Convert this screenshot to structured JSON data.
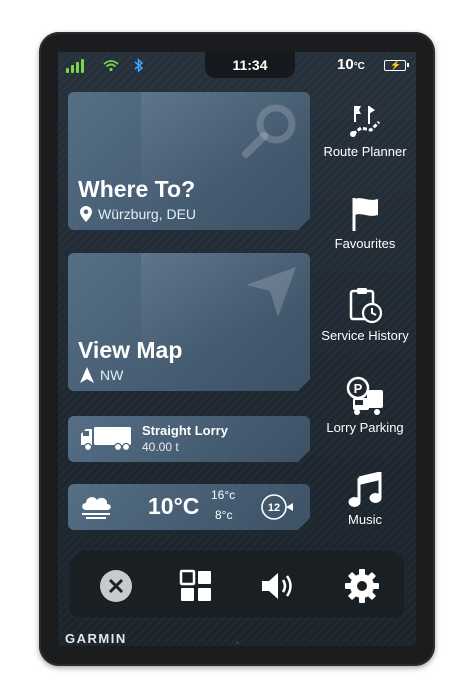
{
  "brand": "GARMIN",
  "status": {
    "time": "11:34",
    "temperature": "10",
    "temperature_unit": "°C"
  },
  "tiles": {
    "where_to": {
      "title": "Where To?",
      "location": "Würzburg, DEU"
    },
    "view_map": {
      "title": "View Map",
      "heading": "NW"
    },
    "vehicle": {
      "title": "Straight Lorry",
      "weight": "40.00 t"
    },
    "weather": {
      "temp": "10°C",
      "high": "16°c",
      "low": "8°c",
      "wind_speed": "12"
    }
  },
  "shortcuts": [
    {
      "label": "Route Planner",
      "icon": "route-planner-icon"
    },
    {
      "label": "Favourites",
      "icon": "flag-icon"
    },
    {
      "label": "Service History",
      "icon": "service-history-icon"
    },
    {
      "label": "Lorry Parking",
      "icon": "lorry-parking-icon"
    },
    {
      "label": "Music",
      "icon": "music-note-icon"
    }
  ],
  "dock": [
    "close-icon",
    "apps-grid-icon",
    "volume-icon",
    "settings-gear-icon"
  ],
  "colors": {
    "tile": "#4e667c",
    "screen_bg": "#222b33",
    "signal": "#7bd34a"
  }
}
